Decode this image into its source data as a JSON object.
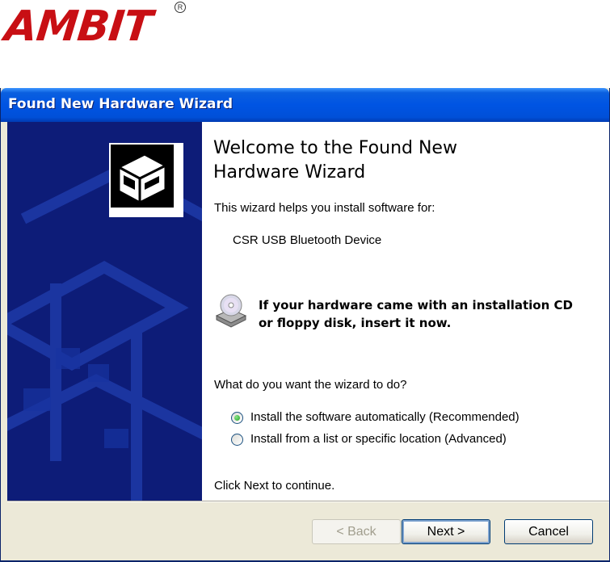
{
  "logo": {
    "text": "AMBIT",
    "registered": "R"
  },
  "window": {
    "title": "Found New Hardware Wizard"
  },
  "content": {
    "heading": "Welcome to the Found New Hardware Wizard",
    "intro": "This wizard helps you install software for:",
    "device": "CSR USB Bluetooth Device",
    "cd_line1": "If your hardware came with an installation CD",
    "cd_line2": "or floppy disk, insert it now.",
    "question": "What do you want the wizard to do?",
    "options": [
      {
        "label": "Install the software automatically (Recommended)",
        "selected": true
      },
      {
        "label": "Install from a list or specific location (Advanced)",
        "selected": false
      }
    ],
    "footer": "Click Next to continue."
  },
  "buttons": {
    "back": "< Back",
    "next": "Next >",
    "cancel": "Cancel"
  },
  "colors": {
    "titlebar": "#0054e3",
    "sidepanel": "#0d1c78",
    "logo": "#c80f14"
  },
  "icons": [
    "hardware-icon",
    "cd-drive-icon",
    "radio-icon"
  ]
}
